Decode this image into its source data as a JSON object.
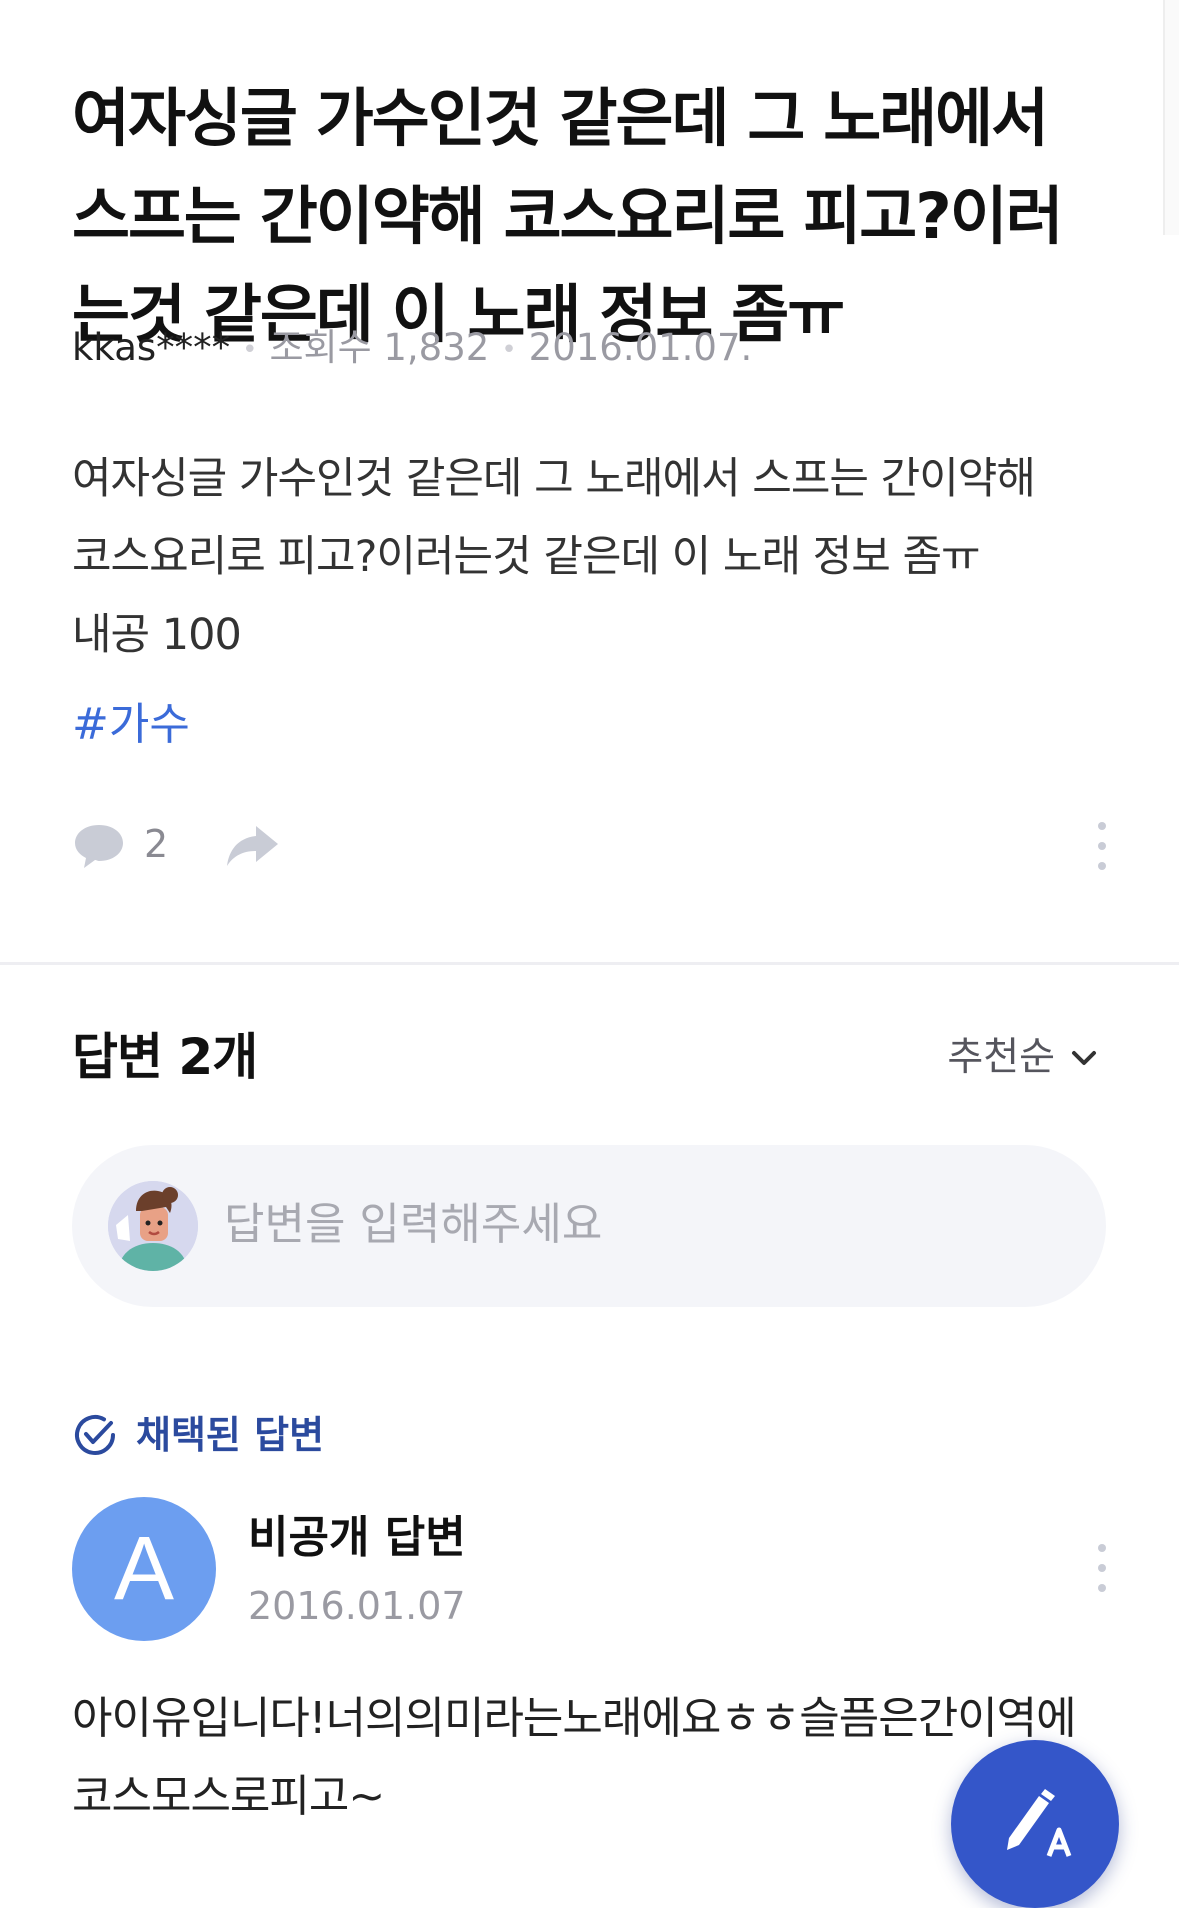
{
  "question": {
    "title": "여자싱글 가수인것 같은데 그 노래에서 스프는 간이약해 코스요리로 피고?이러는것 같은데 이 노래 정보 좀ㅠ",
    "author": "kkas****",
    "views": "조회수 1,832",
    "date": "2016.01.07.",
    "body_lines": [
      "여자싱글 가수인것 같은데 그 노래에서 스프는 간이약해",
      "코스요리로 피고?이러는것 같은데 이 노래 정보 좀ㅠ",
      "내공 100"
    ],
    "hashtag": "#가수",
    "comment_count": "2"
  },
  "answers": {
    "header": "답변 2개",
    "sort_label": "추천순",
    "input_placeholder": "답변을 입력해주세요",
    "chosen_label": "채택된 답변",
    "items": [
      {
        "avatar_letter": "A",
        "name": "비공개 답변",
        "date": "2016.01.07",
        "body_lines": [
          "아이유입니다!너의의미라는노래에요ㅎㅎ슬픔은간이역에",
          "코스모스로피고~"
        ]
      }
    ]
  },
  "icons": {
    "comment": "comment-bubble-icon",
    "share": "share-arrow-icon",
    "more": "more-vertical-icon",
    "sort": "chevron-down-icon",
    "chosen": "check-circle-icon",
    "fab": "write-answer-icon"
  },
  "colors": {
    "hashtag": "#3b6bd9",
    "chosen": "#2b4a9e",
    "avatar": "#6c9ef0",
    "fab": "#3456c9"
  }
}
